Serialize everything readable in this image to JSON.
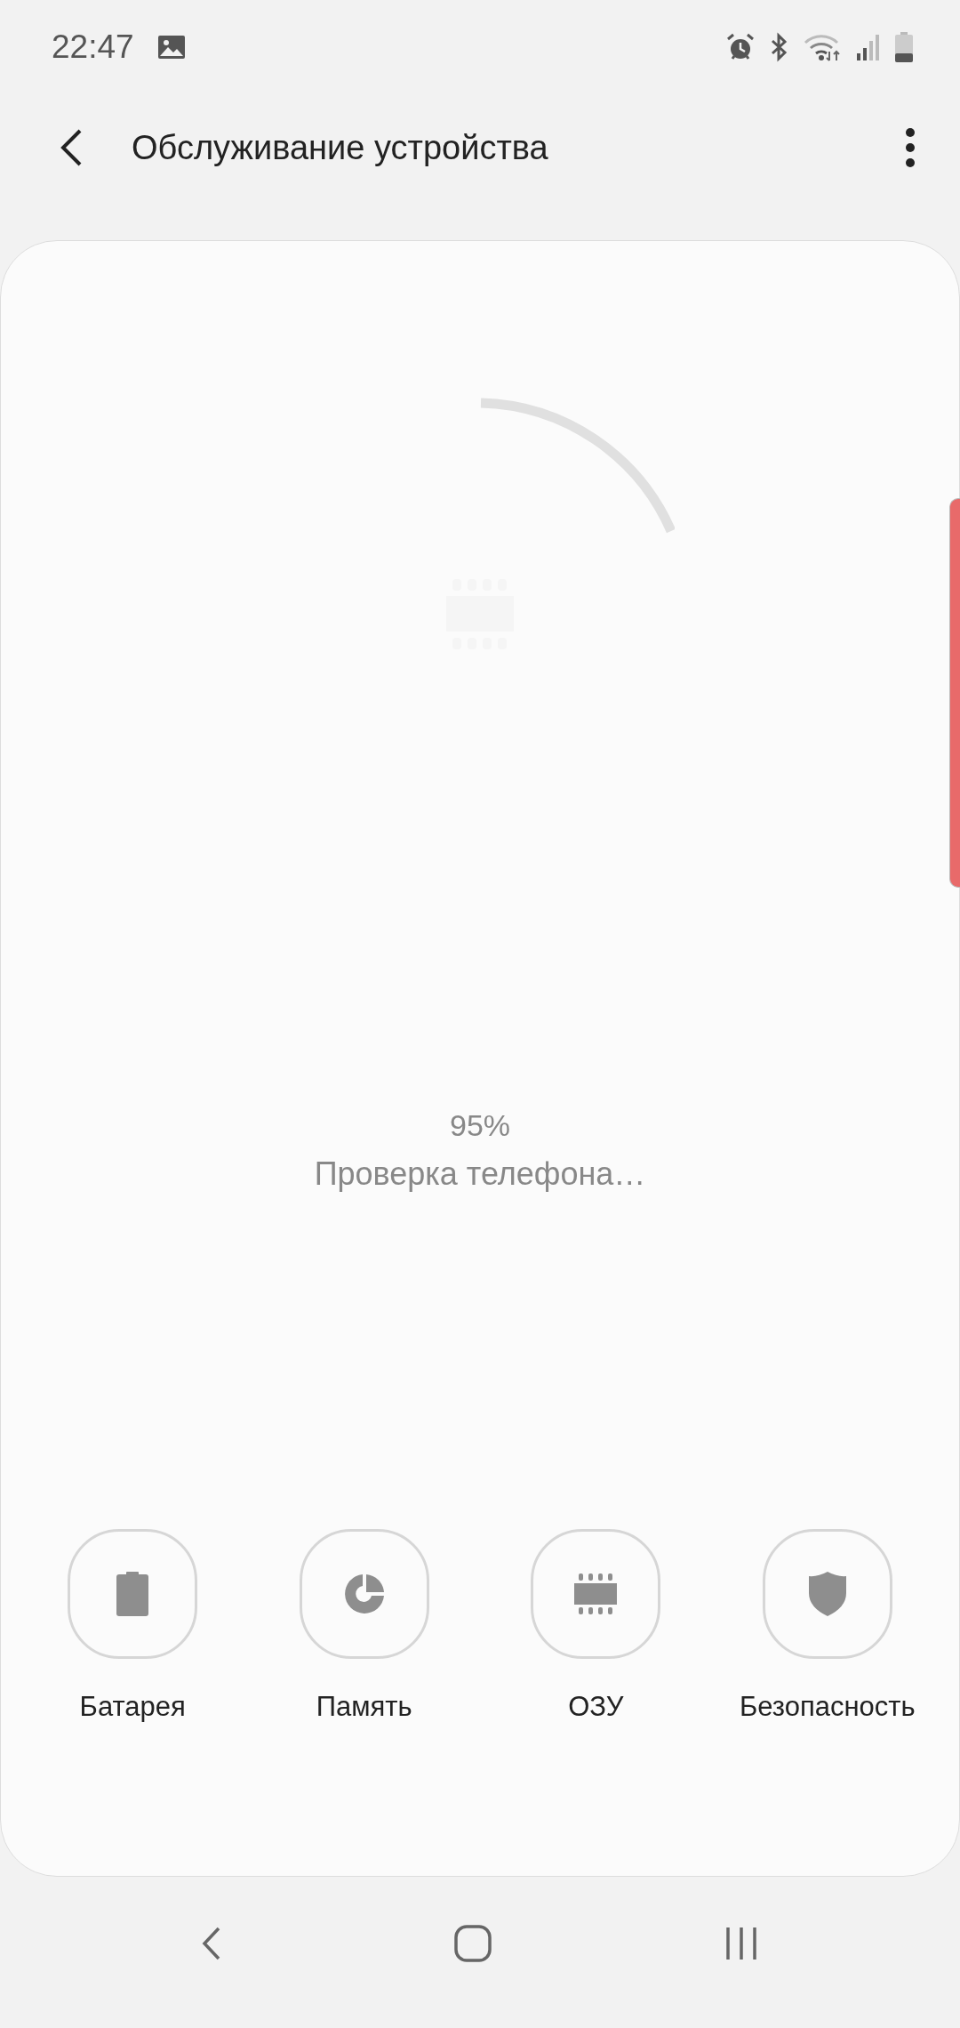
{
  "status_bar": {
    "time": "22:47"
  },
  "app_bar": {
    "title": "Обслуживание устройства"
  },
  "scan": {
    "percent": "95%",
    "message": "Проверка телефона…"
  },
  "categories": [
    {
      "kind": "battery",
      "label": "Батарея"
    },
    {
      "kind": "storage",
      "label": "Память"
    },
    {
      "kind": "memory",
      "label": "ОЗУ"
    },
    {
      "kind": "security",
      "label": "Безопасность"
    }
  ]
}
